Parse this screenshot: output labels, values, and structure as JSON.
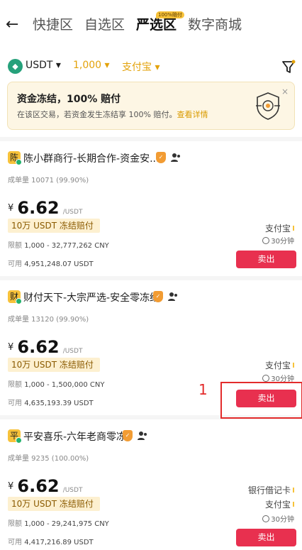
{
  "nav": {
    "back": "←",
    "tabs": [
      "快捷区",
      "自选区",
      "严选区",
      "数字商城"
    ],
    "active_tab_badge": "100%赔付"
  },
  "filters": {
    "coin": "USDT",
    "coin_icon": "usdt-diamond-icon",
    "amount": "1,000",
    "payment": "支付宝"
  },
  "banner": {
    "title": "资金冻结，100% 赔付",
    "subtitle": "在该区交易，若资金发生冻结享 100% 赔付。",
    "link": "查看详情",
    "close": "×"
  },
  "listings": [
    {
      "avatar": "陈",
      "merchant": "陈小群商行-长期合作-资金安...",
      "trades": "成单量 10071 (99.90%)",
      "currency": "¥",
      "price": "6.62",
      "unit": "/USDT",
      "guarantee": "10万 USDT 冻结赔付",
      "limit_key": "限额",
      "limit": "1,000 - 32,777,262 CNY",
      "available_key": "可用",
      "available": "4,951,248.07 USDT",
      "payments": [
        "支付宝"
      ],
      "time": "30分钟",
      "action": "卖出"
    },
    {
      "avatar": "财",
      "merchant": "财付天下-大宗严选-安全零冻结",
      "trades": "成单量 13120 (99.90%)",
      "currency": "¥",
      "price": "6.62",
      "unit": "/USDT",
      "guarantee": "10万 USDT 冻结赔付",
      "limit_key": "限额",
      "limit": "1,000 - 1,500,000 CNY",
      "available_key": "可用",
      "available": "4,635,193.39 USDT",
      "payments": [
        "支付宝"
      ],
      "time": "30分钟",
      "action": "卖出"
    },
    {
      "avatar": "平",
      "merchant": "平安喜乐-六年老商零冻",
      "trades": "成单量 9235 (100.00%)",
      "currency": "¥",
      "price": "6.62",
      "unit": "/USDT",
      "guarantee": "10万 USDT 冻结赔付",
      "limit_key": "限额",
      "limit": "1,000 - 29,241,975 CNY",
      "available_key": "可用",
      "available": "4,417,216.89 USDT",
      "payments": [
        "银行借记卡",
        "支付宝"
      ],
      "time": "30分钟",
      "action": "卖出"
    }
  ],
  "annotation": {
    "label": "1"
  },
  "colors": {
    "accent": "#e3a20a",
    "sell": "#e8304f",
    "annotation": "#e32b2b"
  }
}
